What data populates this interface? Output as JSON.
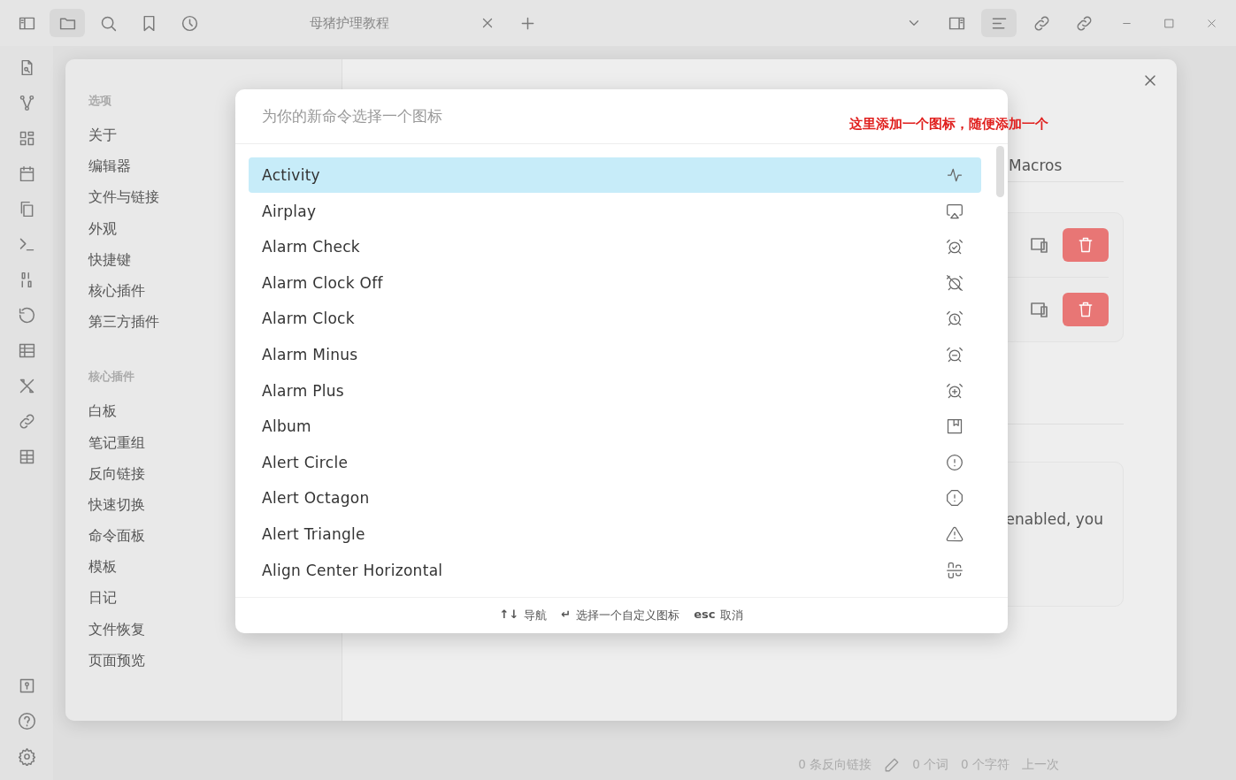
{
  "tab": {
    "title": "母猪护理教程"
  },
  "settings": {
    "sections": [
      {
        "heading": "选项",
        "items": [
          "关于",
          "编辑器",
          "文件与链接",
          "外观",
          "快捷键",
          "核心插件",
          "第三方插件"
        ]
      },
      {
        "heading": "核心插件",
        "items": [
          "白板",
          "笔记重组",
          "反向链接",
          "快速切换",
          "命令面板",
          "模板",
          "日记",
          "文件恢复",
          "页面预览"
        ]
      }
    ],
    "heading": "Macros",
    "card_text": "enabled, you"
  },
  "annotation": "这里添加一个图标，随便添加一个",
  "icon_picker": {
    "placeholder": "为你的新命令选择一个图标",
    "items": [
      {
        "label": "Activity",
        "selected": true
      },
      {
        "label": "Airplay",
        "selected": false
      },
      {
        "label": "Alarm Check",
        "selected": false
      },
      {
        "label": "Alarm Clock Off",
        "selected": false
      },
      {
        "label": "Alarm Clock",
        "selected": false
      },
      {
        "label": "Alarm Minus",
        "selected": false
      },
      {
        "label": "Alarm Plus",
        "selected": false
      },
      {
        "label": "Album",
        "selected": false
      },
      {
        "label": "Alert Circle",
        "selected": false
      },
      {
        "label": "Alert Octagon",
        "selected": false
      },
      {
        "label": "Alert Triangle",
        "selected": false
      },
      {
        "label": "Align Center Horizontal",
        "selected": false
      }
    ],
    "footer": [
      {
        "keys": "↑↓",
        "label": "导航"
      },
      {
        "keys": "↵",
        "label": "选择一个自定义图标"
      },
      {
        "keys": "esc",
        "label": "取消"
      }
    ]
  },
  "status_bar": {
    "backlinks": "0 条反向链接",
    "words": "0 个词",
    "chars": "0 个字符",
    "last": "上一次"
  }
}
